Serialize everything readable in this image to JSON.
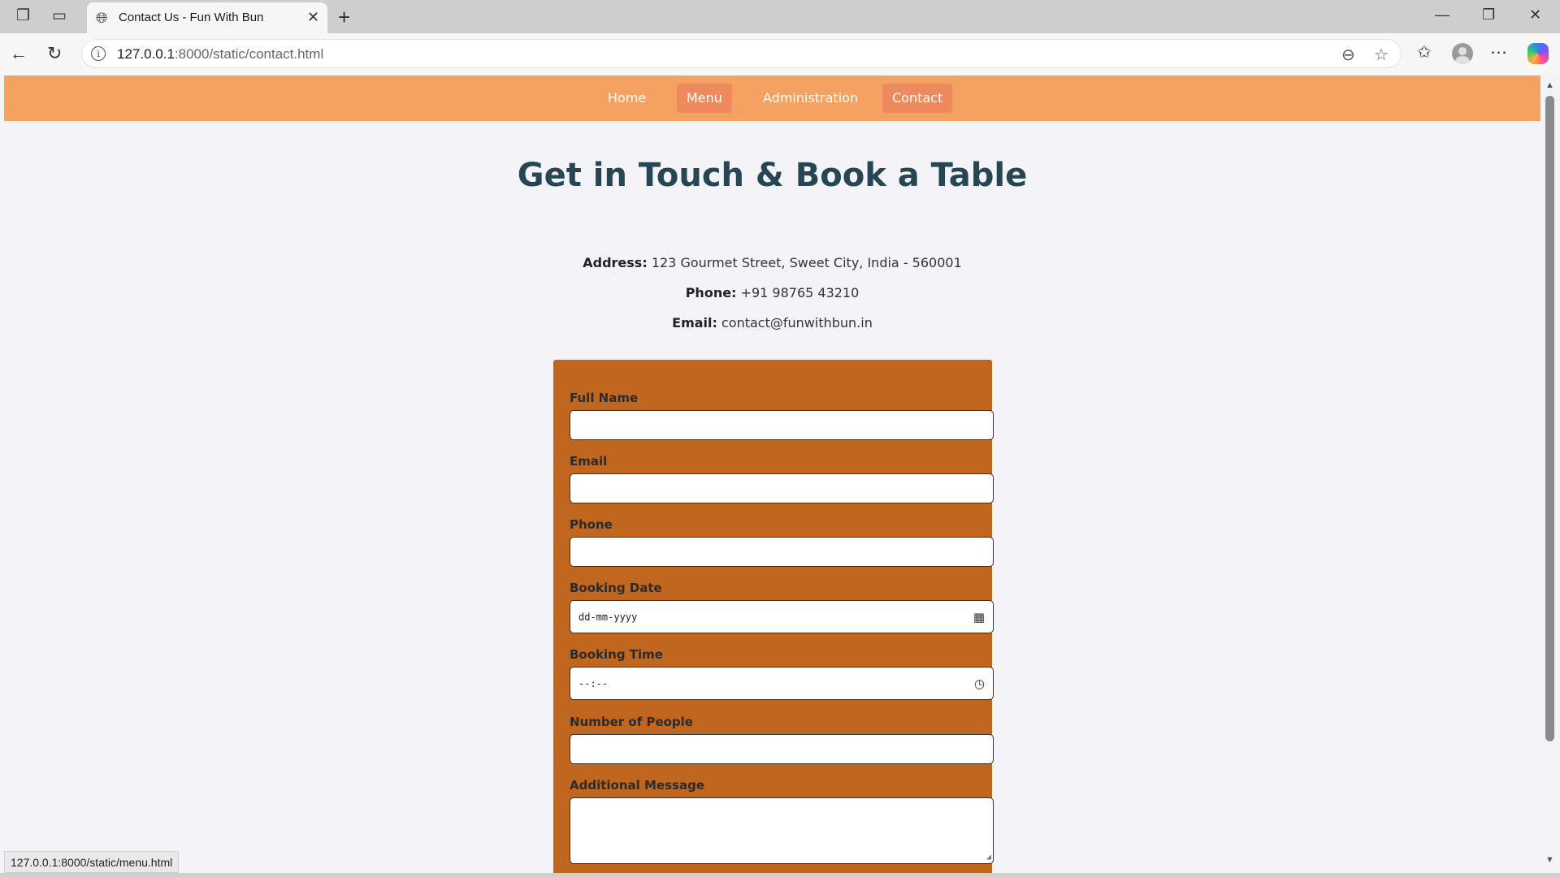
{
  "browser": {
    "tab_title": "Contact Us - Fun With Bun",
    "url_host": "127.0.0.1",
    "url_rest": ":8000/static/contact.html",
    "status_url": "127.0.0.1:8000/static/menu.html",
    "icons": {
      "workspaces": "workspaces-icon",
      "tab_actions": "tab-actions-icon",
      "globe": "globe-icon",
      "close_tab": "close-icon",
      "new_tab": "plus-icon",
      "minimize": "minimize-icon",
      "restore": "restore-icon",
      "close_window": "close-icon",
      "back": "back-arrow-icon",
      "refresh": "refresh-icon",
      "site_info": "info-icon",
      "zoom": "zoom-out-icon",
      "favorite": "star-icon",
      "favorites": "favorites-icon",
      "profile": "avatar",
      "more": "more-icon",
      "copilot": "copilot-icon"
    }
  },
  "site_nav": {
    "items": [
      {
        "label": "Home",
        "highlighted": false
      },
      {
        "label": "Menu",
        "highlighted": true
      },
      {
        "label": "Administration",
        "highlighted": false
      },
      {
        "label": "Contact",
        "highlighted": true
      }
    ],
    "background": "#f4a261",
    "highlight": "#ef8a5e"
  },
  "page": {
    "title": "Get in Touch & Book a Table",
    "address_label": "Address:",
    "address_value": "123 Gourmet Street, Sweet City, India - 560001",
    "phone_label": "Phone:",
    "phone_value": "+91 98765 43210",
    "email_label": "Email:",
    "email_value": "contact@funwithbun.in"
  },
  "form": {
    "background": "#c0661f",
    "fields": {
      "full_name": {
        "label": "Full Name",
        "value": ""
      },
      "email": {
        "label": "Email",
        "value": ""
      },
      "phone": {
        "label": "Phone",
        "value": ""
      },
      "booking_date": {
        "label": "Booking Date",
        "placeholder": "dd-mm-yyyy",
        "icon": "calendar-icon"
      },
      "booking_time": {
        "label": "Booking Time",
        "placeholder": "--:--",
        "icon": "clock-icon"
      },
      "people": {
        "label": "Number of People",
        "value": ""
      },
      "message": {
        "label": "Additional Message",
        "value": ""
      }
    }
  }
}
